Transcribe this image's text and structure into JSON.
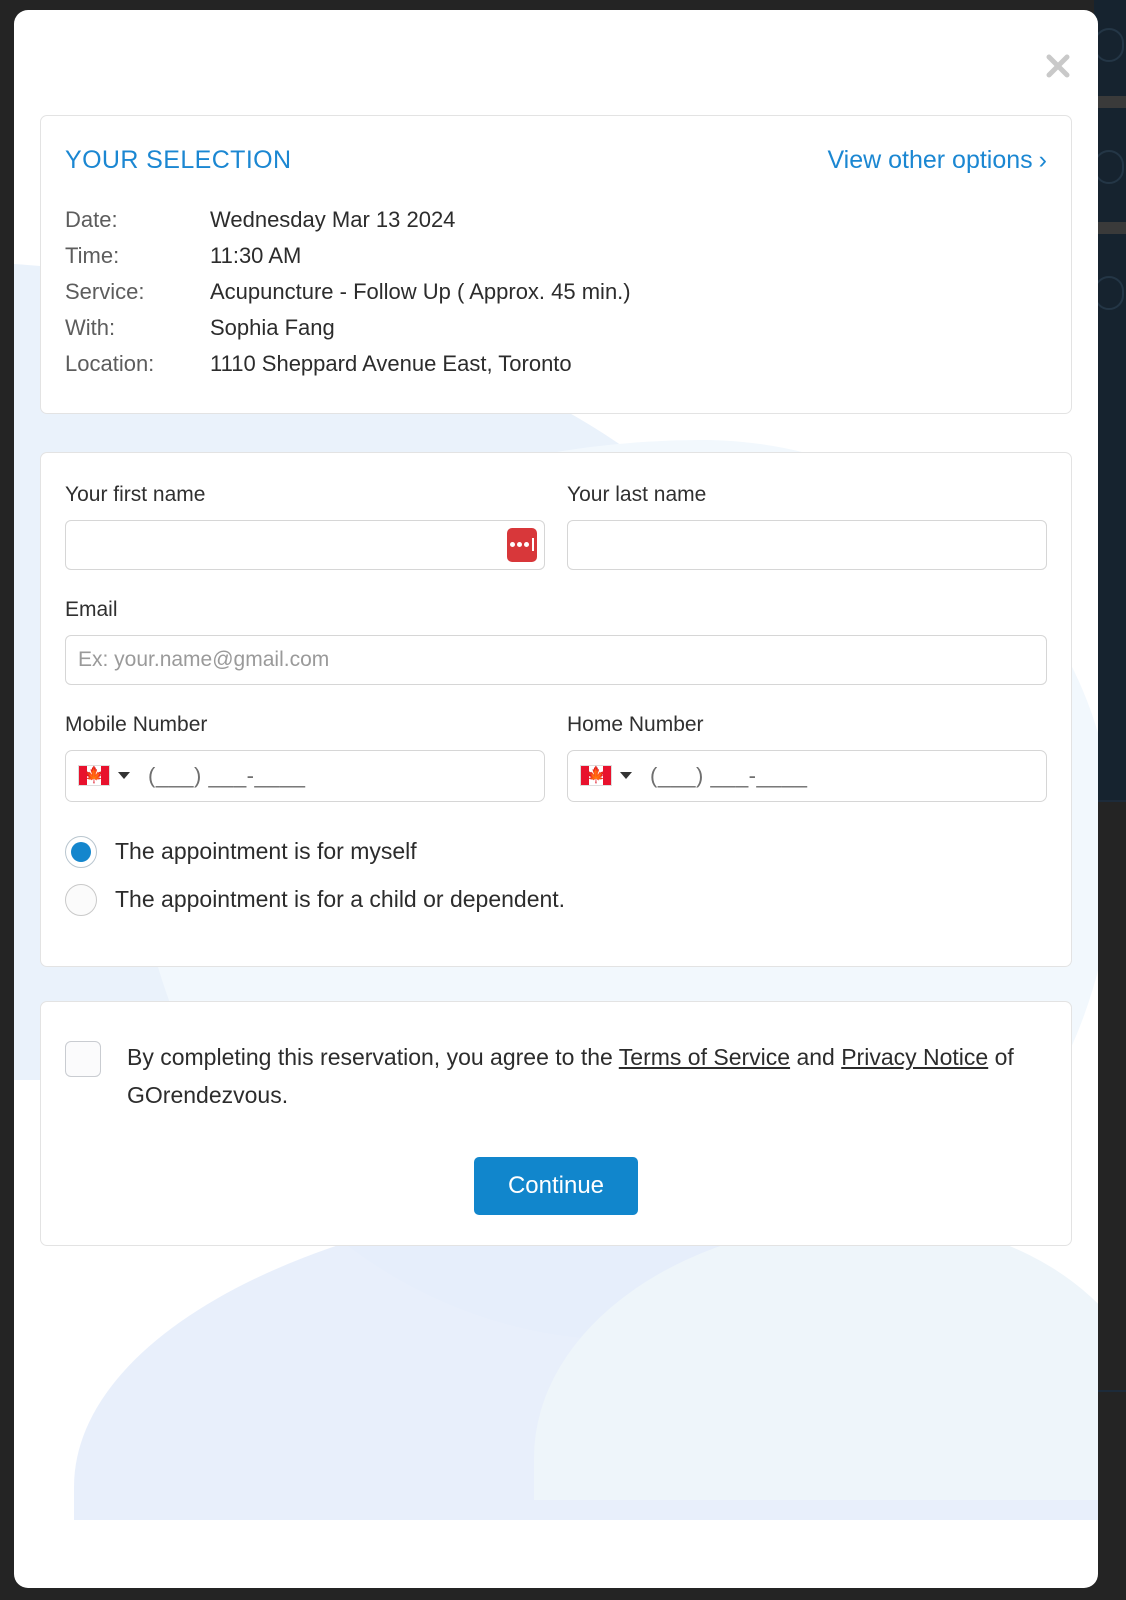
{
  "modal": {
    "close_icon": "close-icon"
  },
  "selection": {
    "title": "YOUR SELECTION",
    "view_other_options": "View other options",
    "chevron": "›",
    "rows": [
      {
        "key": "Date:",
        "value": "Wednesday Mar 13 2024"
      },
      {
        "key": "Time:",
        "value": "11:30 AM"
      },
      {
        "key": "Service:",
        "value": "Acupuncture - Follow Up ( Approx. 45 min.)"
      },
      {
        "key": "With:",
        "value": "Sophia Fang"
      },
      {
        "key": "Location:",
        "value": "1110 Sheppard Avenue East, Toronto"
      }
    ]
  },
  "form": {
    "first_name": {
      "label": "Your first name",
      "value": "",
      "placeholder": ""
    },
    "last_name": {
      "label": "Your last name",
      "value": "",
      "placeholder": ""
    },
    "email": {
      "label": "Email",
      "value": "",
      "placeholder": "Ex: your.name@gmail.com"
    },
    "mobile": {
      "label": "Mobile Number",
      "country": "Canada",
      "placeholder": "(___) ___-____"
    },
    "home": {
      "label": "Home Number",
      "country": "Canada",
      "placeholder": "(___) ___-____"
    },
    "autofill_icon": "lastpass-icon",
    "radios": [
      {
        "label": "The appointment is for myself",
        "selected": true
      },
      {
        "label": "The appointment is for a child or dependent.",
        "selected": false
      }
    ]
  },
  "terms": {
    "checked": false,
    "text_part1": "By completing this reservation, you agree to the ",
    "link_terms": "Terms of Service",
    "text_part2": " and ",
    "link_privacy": "Privacy Notice",
    "text_part3": " of GOrendezvous.",
    "continue_label": "Continue"
  },
  "colors": {
    "accent_blue": "#1b87d2",
    "button_blue": "#1186cc",
    "radio_blue": "#1486cd",
    "lastpass_red": "#d8373a",
    "flag_red": "#e8112d"
  }
}
